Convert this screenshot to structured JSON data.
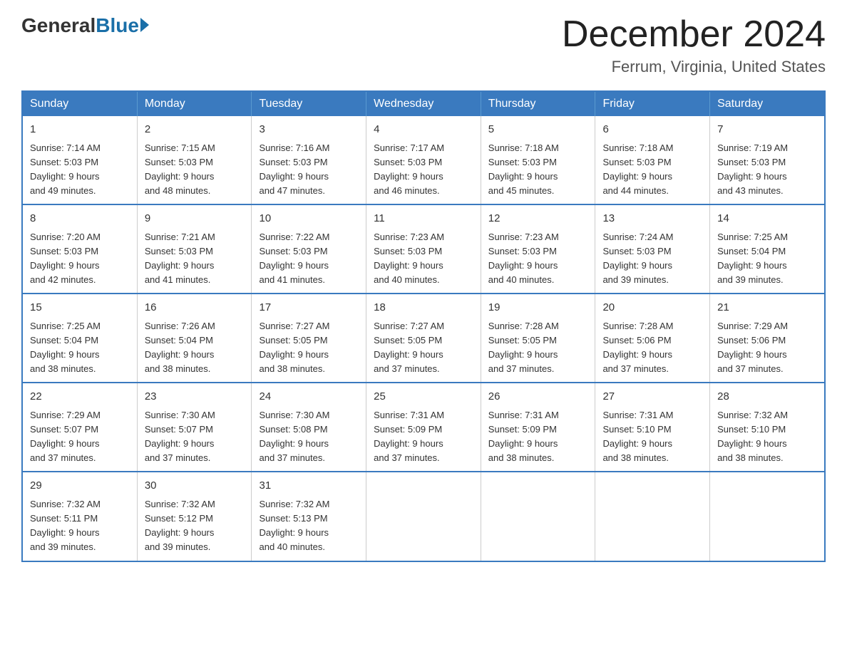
{
  "logo": {
    "general": "General",
    "blue": "Blue"
  },
  "title": "December 2024",
  "location": "Ferrum, Virginia, United States",
  "days_of_week": [
    "Sunday",
    "Monday",
    "Tuesday",
    "Wednesday",
    "Thursday",
    "Friday",
    "Saturday"
  ],
  "weeks": [
    [
      {
        "day": "1",
        "sunrise": "7:14 AM",
        "sunset": "5:03 PM",
        "daylight": "9 hours and 49 minutes."
      },
      {
        "day": "2",
        "sunrise": "7:15 AM",
        "sunset": "5:03 PM",
        "daylight": "9 hours and 48 minutes."
      },
      {
        "day": "3",
        "sunrise": "7:16 AM",
        "sunset": "5:03 PM",
        "daylight": "9 hours and 47 minutes."
      },
      {
        "day": "4",
        "sunrise": "7:17 AM",
        "sunset": "5:03 PM",
        "daylight": "9 hours and 46 minutes."
      },
      {
        "day": "5",
        "sunrise": "7:18 AM",
        "sunset": "5:03 PM",
        "daylight": "9 hours and 45 minutes."
      },
      {
        "day": "6",
        "sunrise": "7:18 AM",
        "sunset": "5:03 PM",
        "daylight": "9 hours and 44 minutes."
      },
      {
        "day": "7",
        "sunrise": "7:19 AM",
        "sunset": "5:03 PM",
        "daylight": "9 hours and 43 minutes."
      }
    ],
    [
      {
        "day": "8",
        "sunrise": "7:20 AM",
        "sunset": "5:03 PM",
        "daylight": "9 hours and 42 minutes."
      },
      {
        "day": "9",
        "sunrise": "7:21 AM",
        "sunset": "5:03 PM",
        "daylight": "9 hours and 41 minutes."
      },
      {
        "day": "10",
        "sunrise": "7:22 AM",
        "sunset": "5:03 PM",
        "daylight": "9 hours and 41 minutes."
      },
      {
        "day": "11",
        "sunrise": "7:23 AM",
        "sunset": "5:03 PM",
        "daylight": "9 hours and 40 minutes."
      },
      {
        "day": "12",
        "sunrise": "7:23 AM",
        "sunset": "5:03 PM",
        "daylight": "9 hours and 40 minutes."
      },
      {
        "day": "13",
        "sunrise": "7:24 AM",
        "sunset": "5:03 PM",
        "daylight": "9 hours and 39 minutes."
      },
      {
        "day": "14",
        "sunrise": "7:25 AM",
        "sunset": "5:04 PM",
        "daylight": "9 hours and 39 minutes."
      }
    ],
    [
      {
        "day": "15",
        "sunrise": "7:25 AM",
        "sunset": "5:04 PM",
        "daylight": "9 hours and 38 minutes."
      },
      {
        "day": "16",
        "sunrise": "7:26 AM",
        "sunset": "5:04 PM",
        "daylight": "9 hours and 38 minutes."
      },
      {
        "day": "17",
        "sunrise": "7:27 AM",
        "sunset": "5:05 PM",
        "daylight": "9 hours and 38 minutes."
      },
      {
        "day": "18",
        "sunrise": "7:27 AM",
        "sunset": "5:05 PM",
        "daylight": "9 hours and 37 minutes."
      },
      {
        "day": "19",
        "sunrise": "7:28 AM",
        "sunset": "5:05 PM",
        "daylight": "9 hours and 37 minutes."
      },
      {
        "day": "20",
        "sunrise": "7:28 AM",
        "sunset": "5:06 PM",
        "daylight": "9 hours and 37 minutes."
      },
      {
        "day": "21",
        "sunrise": "7:29 AM",
        "sunset": "5:06 PM",
        "daylight": "9 hours and 37 minutes."
      }
    ],
    [
      {
        "day": "22",
        "sunrise": "7:29 AM",
        "sunset": "5:07 PM",
        "daylight": "9 hours and 37 minutes."
      },
      {
        "day": "23",
        "sunrise": "7:30 AM",
        "sunset": "5:07 PM",
        "daylight": "9 hours and 37 minutes."
      },
      {
        "day": "24",
        "sunrise": "7:30 AM",
        "sunset": "5:08 PM",
        "daylight": "9 hours and 37 minutes."
      },
      {
        "day": "25",
        "sunrise": "7:31 AM",
        "sunset": "5:09 PM",
        "daylight": "9 hours and 37 minutes."
      },
      {
        "day": "26",
        "sunrise": "7:31 AM",
        "sunset": "5:09 PM",
        "daylight": "9 hours and 38 minutes."
      },
      {
        "day": "27",
        "sunrise": "7:31 AM",
        "sunset": "5:10 PM",
        "daylight": "9 hours and 38 minutes."
      },
      {
        "day": "28",
        "sunrise": "7:32 AM",
        "sunset": "5:10 PM",
        "daylight": "9 hours and 38 minutes."
      }
    ],
    [
      {
        "day": "29",
        "sunrise": "7:32 AM",
        "sunset": "5:11 PM",
        "daylight": "9 hours and 39 minutes."
      },
      {
        "day": "30",
        "sunrise": "7:32 AM",
        "sunset": "5:12 PM",
        "daylight": "9 hours and 39 minutes."
      },
      {
        "day": "31",
        "sunrise": "7:32 AM",
        "sunset": "5:13 PM",
        "daylight": "9 hours and 40 minutes."
      },
      null,
      null,
      null,
      null
    ]
  ]
}
